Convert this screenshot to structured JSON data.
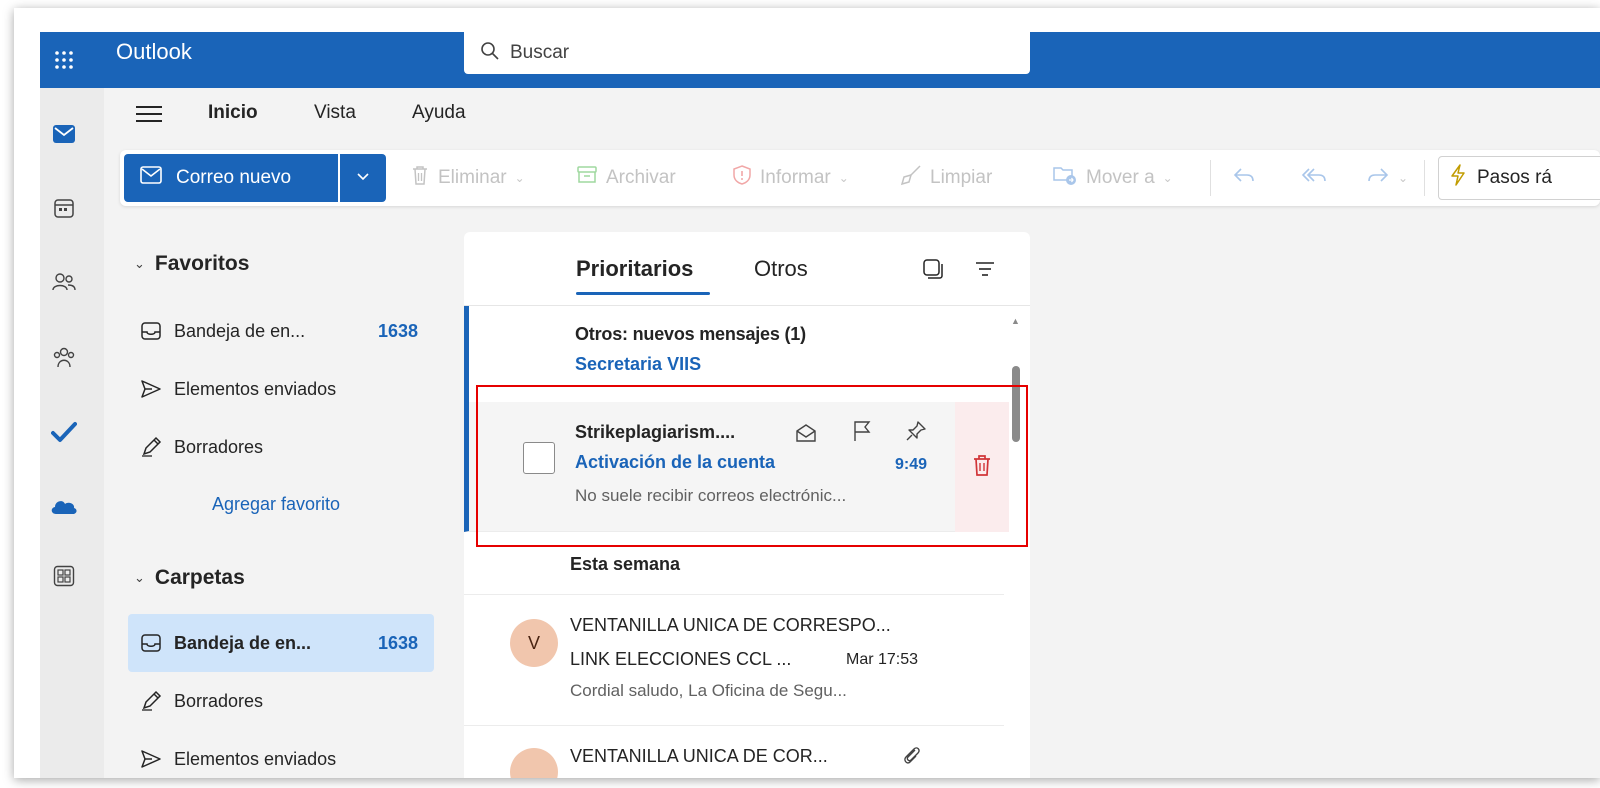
{
  "app": {
    "title": "Outlook"
  },
  "search": {
    "placeholder": "Buscar"
  },
  "rail": {
    "items": [
      "mail-icon",
      "calendar-icon",
      "people-icon",
      "groups-icon",
      "todo-icon",
      "onedrive-icon",
      "apps-icon"
    ]
  },
  "ribbon": {
    "tabs": [
      "Inicio",
      "Vista",
      "Ayuda"
    ],
    "active_tab": "Inicio",
    "new_mail": "Correo nuevo",
    "commands": {
      "delete": "Eliminar",
      "archive": "Archivar",
      "report": "Informar",
      "sweep": "Limpiar",
      "move": "Mover a"
    },
    "quick_steps": "Pasos rá"
  },
  "folders": {
    "favorites_title": "Favoritos",
    "favorites": [
      {
        "label": "Bandeja de en...",
        "count": "1638",
        "icon": "inbox-icon"
      },
      {
        "label": "Elementos enviados",
        "icon": "sent-icon"
      },
      {
        "label": "Borradores",
        "icon": "drafts-icon"
      }
    ],
    "add_favorite": "Agregar favorito",
    "folders_title": "Carpetas",
    "folders": [
      {
        "label": "Bandeja de en...",
        "count": "1638",
        "icon": "inbox-icon",
        "selected": true
      },
      {
        "label": "Borradores",
        "icon": "drafts-icon"
      },
      {
        "label": "Elementos enviados",
        "icon": "sent-icon"
      }
    ]
  },
  "message_list": {
    "tabs": [
      "Prioritarios",
      "Otros"
    ],
    "active_tab": "Prioritarios",
    "other_notice": {
      "title": "Otros: nuevos mensajes (1)",
      "sender": "Secretaria VIIS"
    },
    "messages": [
      {
        "sender": "Strikeplagiarism....",
        "subject": "Activación de la cuenta",
        "preview": "No suele recibir correos electrónic...",
        "time": "9:49",
        "unread": true
      }
    ],
    "group_header": "Esta semana",
    "week_messages": [
      {
        "avatar": "V",
        "sender": "VENTANILLA UNICA DE CORRESPO...",
        "subject": "LINK ELECCIONES CCL ...",
        "preview": "Cordial saludo, La Oficina de Segu...",
        "time": "Mar 17:53"
      },
      {
        "avatar": "",
        "sender": "VENTANILLA UNICA DE COR...",
        "subject": "",
        "preview": "",
        "time": ""
      }
    ]
  },
  "colors": {
    "brand": "#1a64b8",
    "selected_folder": "#cfe4fa",
    "delete_red": "#d13438",
    "highlight": "#e60000"
  }
}
